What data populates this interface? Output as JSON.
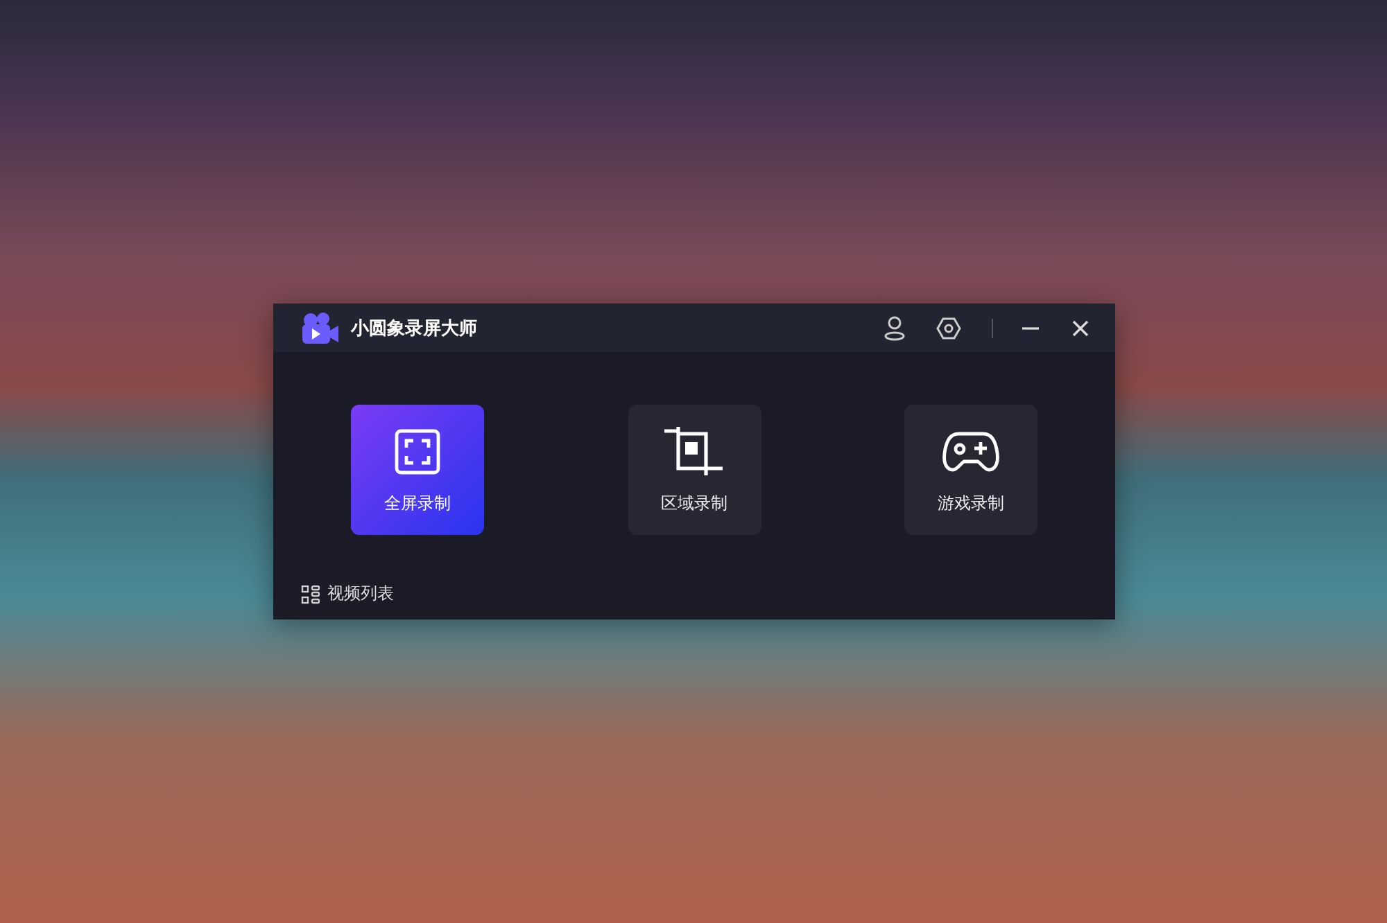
{
  "window": {
    "title": "小圆象录屏大师"
  },
  "modes": [
    {
      "kind": "fullscreen",
      "label": "全屏录制",
      "selected": true
    },
    {
      "kind": "region",
      "label": "区域录制",
      "selected": false
    },
    {
      "kind": "game",
      "label": "游戏录制",
      "selected": false
    }
  ],
  "footer": {
    "link": "视频列表"
  }
}
